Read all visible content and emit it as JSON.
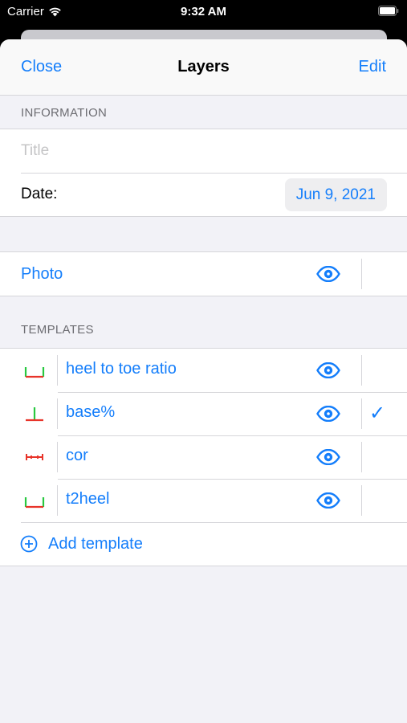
{
  "status_bar": {
    "carrier": "Carrier",
    "time": "9:32 AM"
  },
  "navbar": {
    "close_label": "Close",
    "title": "Layers",
    "edit_label": "Edit"
  },
  "information": {
    "header": "INFORMATION",
    "title_placeholder": "Title",
    "title_value": "",
    "date_label": "Date:",
    "date_value": "Jun 9, 2021"
  },
  "photo_layer": {
    "label": "Photo",
    "visible": true,
    "icon": "eye-icon"
  },
  "templates": {
    "header": "TEMPLATES",
    "items": [
      {
        "label": "heel to toe ratio",
        "icon": "bracket-template-icon",
        "visible": true,
        "selected": false
      },
      {
        "label": "base%",
        "icon": "perpendicular-template-icon",
        "visible": true,
        "selected": true
      },
      {
        "label": "cor",
        "icon": "ruler-template-icon",
        "visible": true,
        "selected": false
      },
      {
        "label": "t2heel",
        "icon": "bracket-template-icon",
        "visible": true,
        "selected": false
      }
    ],
    "add_label": "Add template",
    "add_icon": "plus-circle-icon"
  },
  "colors": {
    "accent": "#147efb",
    "template_green": "#28c840",
    "template_red": "#e8342a",
    "checkmark": "✓"
  }
}
